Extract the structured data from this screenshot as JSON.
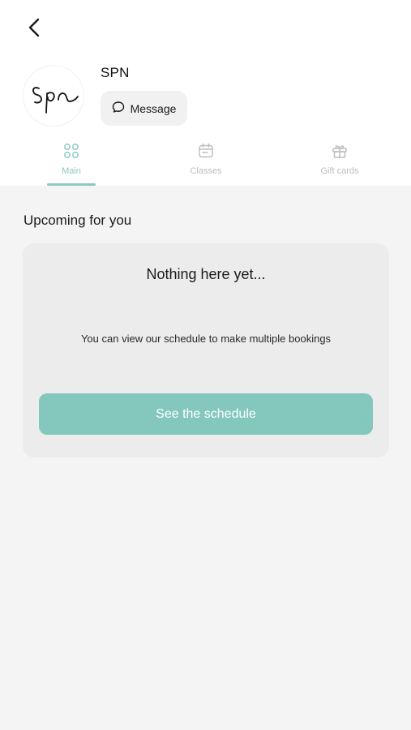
{
  "header": {
    "back_icon": "chevron-left-icon",
    "studio_name": "SPN",
    "avatar_logo_text": "Spn",
    "message_button_label": "Message",
    "message_icon": "chat-bubble-icon"
  },
  "tabs": [
    {
      "label": "Main",
      "icon": "grid-icon",
      "active": true
    },
    {
      "label": "Classes",
      "icon": "calendar-icon",
      "active": false
    },
    {
      "label": "Gift cards",
      "icon": "gift-icon",
      "active": false
    }
  ],
  "upcoming": {
    "title": "Upcoming for you",
    "empty_title": "Nothing here yet...",
    "empty_text": "You can view our schedule to make multiple bookings",
    "cta_label": "See the schedule"
  },
  "colors": {
    "accent": "#84c8bd",
    "tab_active": "#8cc9bf",
    "tab_inactive": "#bdbdbd",
    "background": "#f4f4f4",
    "card": "#ececec"
  }
}
